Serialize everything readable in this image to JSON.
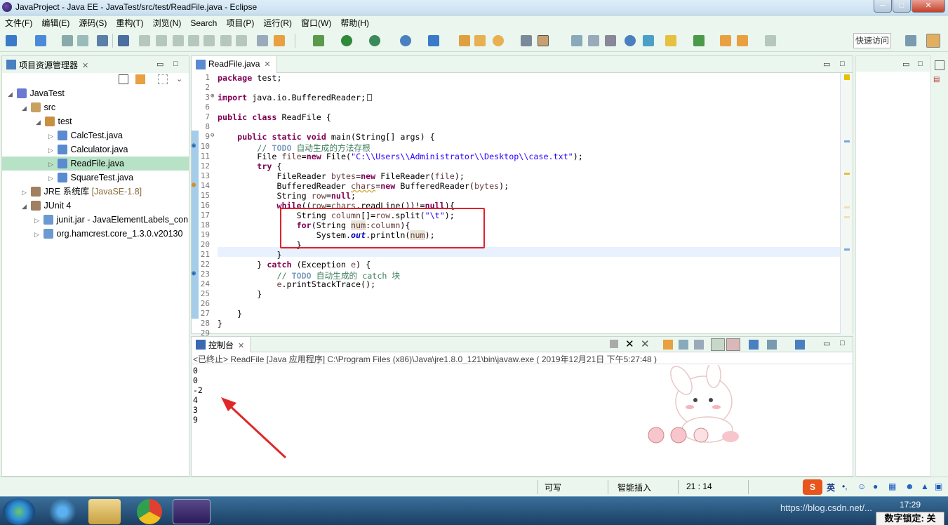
{
  "window": {
    "title": "JavaProject - Java EE - JavaTest/src/test/ReadFile.java - Eclipse",
    "buttons": [
      "─",
      "□",
      "✕"
    ]
  },
  "menu": [
    "文件(F)",
    "编辑(E)",
    "源码(S)",
    "重构(T)",
    "浏览(N)",
    "Search",
    "项目(P)",
    "运行(R)",
    "窗口(W)",
    "帮助(H)"
  ],
  "toolbar": {
    "quick_access": "快速访问"
  },
  "project_explorer": {
    "tab_label": "项目资源管理器",
    "items": [
      {
        "label": "JavaTest",
        "extra": ""
      },
      {
        "label": "src",
        "extra": ""
      },
      {
        "label": "test",
        "extra": ""
      },
      {
        "label": "CalcTest.java",
        "extra": ""
      },
      {
        "label": "Calculator.java",
        "extra": ""
      },
      {
        "label": "ReadFile.java",
        "extra": ""
      },
      {
        "label": "SquareTest.java",
        "extra": ""
      },
      {
        "label": "JRE 系统库",
        "extra": "[JavaSE-1.8]"
      },
      {
        "label": "JUnit 4",
        "extra": ""
      },
      {
        "label": "junit.jar - JavaElementLabels_con",
        "extra": ""
      },
      {
        "label": "org.hamcrest.core_1.3.0.v20130",
        "extra": ""
      }
    ]
  },
  "editor": {
    "tab_label": "ReadFile.java",
    "line_numbers": [
      "1",
      "2",
      "3",
      "6",
      "7",
      "8",
      "9",
      "10",
      "11",
      "12",
      "13",
      "14",
      "15",
      "16",
      "17",
      "18",
      "19",
      "20",
      "21",
      "22",
      "23",
      "24",
      "25",
      "26",
      "27",
      "28",
      "29"
    ],
    "lines": {
      "l1": [
        "package",
        " test;"
      ],
      "l3": [
        "import",
        " java.io.BufferedReader;"
      ],
      "l7": [
        "public",
        " ",
        "class",
        " ReadFile {"
      ],
      "l9": [
        "    ",
        "public",
        " ",
        "static",
        " ",
        "void",
        " main(String[] args) {"
      ],
      "l10": [
        "        // ",
        "TODO",
        " 自动生成的方法存根"
      ],
      "l11": [
        "        File ",
        "file",
        "=",
        "new",
        " File(",
        "\"C:\\\\Users\\\\Administrator\\\\Desktop\\\\case.txt\"",
        ");"
      ],
      "l12": [
        "        ",
        "try",
        " {"
      ],
      "l13": [
        "            FileReader ",
        "bytes",
        "=",
        "new",
        " FileReader(",
        "file",
        ");"
      ],
      "l14": [
        "            BufferedReader ",
        "chars",
        "=",
        "new",
        " BufferedReader(",
        "bytes",
        ");"
      ],
      "l15": [
        "            String ",
        "row",
        "=",
        "null",
        ";"
      ],
      "l16": [
        "            ",
        "while",
        "((",
        "row",
        "=",
        "chars",
        ".readLine())!=",
        "null",
        "){"
      ],
      "l17": [
        "                String ",
        "column",
        "[]=",
        "row",
        ".split(",
        "\"\\t\"",
        ");"
      ],
      "l18": [
        "                ",
        "for",
        "(String ",
        "num",
        ":",
        "column",
        "){"
      ],
      "l19": [
        "                    System.",
        "out",
        ".println(",
        "num",
        ");"
      ],
      "l20": [
        "                }"
      ],
      "l21": [
        "            }"
      ],
      "l22": [
        "        } ",
        "catch",
        " (Exception ",
        "e",
        ") {"
      ],
      "l23": [
        "            // ",
        "TODO",
        " 自动生成的 catch 块"
      ],
      "l24": [
        "            ",
        "e",
        ".printStackTrace();"
      ],
      "l25": [
        "        }"
      ],
      "l27": [
        "    }"
      ],
      "l28": [
        "}"
      ]
    }
  },
  "console": {
    "tab_label": "控制台",
    "header": "<已终止> ReadFile [Java 应用程序] C:\\Program Files (x86)\\Java\\jre1.8.0_121\\bin\\javaw.exe ( 2019年12月21日 下午5:27:48 )",
    "output": [
      "0",
      "0",
      "-2",
      "4",
      "3",
      "9"
    ]
  },
  "status": {
    "writable": "可写",
    "insert_mode": "智能插入",
    "position": "21 : 14"
  },
  "taskbar": {
    "time": "17:29",
    "ime_lang": "英",
    "numlock": "数字锁定: 关",
    "watermark": "https://blog.csdn.net/..."
  }
}
